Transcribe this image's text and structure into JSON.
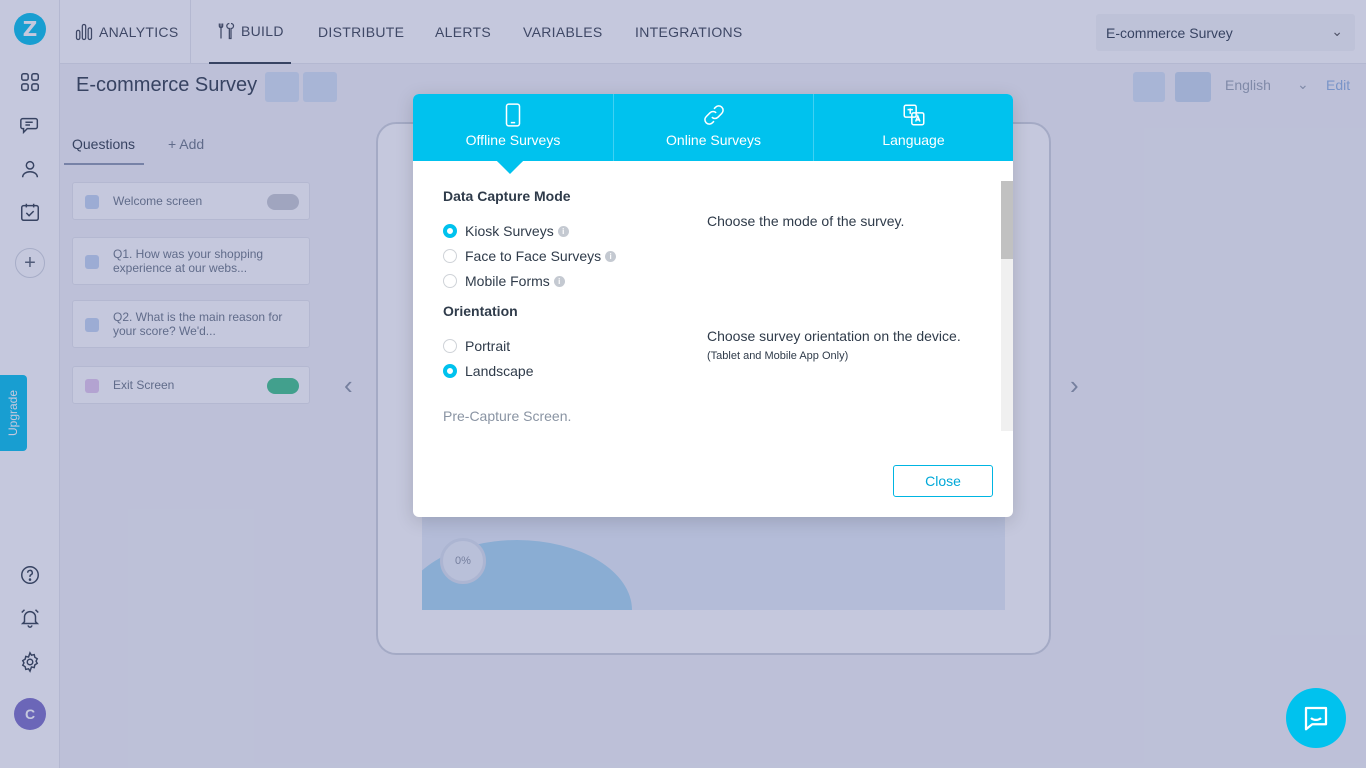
{
  "app": {
    "logo_letter": "Z"
  },
  "nav": {
    "analytics": "ANALYTICS",
    "build": "BUILD",
    "distribute": "DISTRIBUTE",
    "alerts": "ALERTS",
    "variables": "VARIABLES",
    "integrations": "INTEGRATIONS"
  },
  "survey_selector": {
    "value": "E-commerce Survey"
  },
  "sidebar": {
    "upgrade_label": "Upgrade",
    "avatar_letter": "C"
  },
  "background": {
    "survey_title": "E-commerce Survey",
    "tabs": {
      "questions": "Questions",
      "add": "+ Add"
    },
    "questions": [
      {
        "label": "Welcome screen"
      },
      {
        "label": "Q1. How was your shopping experience at our webs..."
      },
      {
        "label": "Q2. What is the main reason for your score? We'd..."
      },
      {
        "label": "Exit Screen"
      }
    ],
    "progress_label": "0%",
    "language": "English",
    "edit_label": "Edit"
  },
  "modal": {
    "tabs": [
      {
        "label": "Offline Surveys",
        "icon": "mobile-icon",
        "active": true
      },
      {
        "label": "Online Surveys",
        "icon": "link-icon",
        "active": false
      },
      {
        "label": "Language",
        "icon": "translate-icon",
        "active": false
      }
    ],
    "data_capture": {
      "title": "Data Capture Mode",
      "options": [
        {
          "label": "Kiosk Surveys",
          "checked": true
        },
        {
          "label": "Face to Face Surveys",
          "checked": false
        },
        {
          "label": "Mobile Forms",
          "checked": false
        }
      ],
      "description": "Choose the mode of the survey."
    },
    "orientation": {
      "title": "Orientation",
      "options": [
        {
          "label": "Portrait",
          "checked": false
        },
        {
          "label": "Landscape",
          "checked": true
        }
      ],
      "description": "Choose survey orientation on the device.",
      "description_sub": "(Tablet and Mobile App Only)"
    },
    "pre_capture_label": "Pre-Capture Screen.",
    "close_label": "Close"
  },
  "colors": {
    "accent": "#00c2ee",
    "overlay": "#4a5596"
  }
}
